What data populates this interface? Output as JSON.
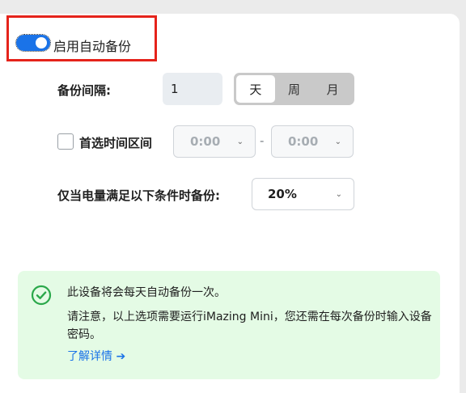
{
  "toggle": {
    "label": "启用自动备份",
    "on": true
  },
  "interval": {
    "label": "备份间隔:",
    "value": "1",
    "units": [
      {
        "label": "天",
        "active": true
      },
      {
        "label": "周",
        "active": false
      },
      {
        "label": "月",
        "active": false
      }
    ]
  },
  "preferred_time": {
    "label": "首选时间区间",
    "checked": false,
    "start": "0:00",
    "separator": "-",
    "end": "0:00"
  },
  "battery": {
    "label": "仅当电量满足以下条件时备份:",
    "value": "20%"
  },
  "info": {
    "line1": "此设备将会每天自动备份一次。",
    "line2": "请注意，以上选项需要运行iMazing Mini，您还需在每次备份时输入设备密码。",
    "link": "了解详情 ➔"
  },
  "colors": {
    "accent": "#1a73e8",
    "highlight": "#e5231b",
    "success": "#2aa84a",
    "info_bg": "#e4fbe5"
  }
}
